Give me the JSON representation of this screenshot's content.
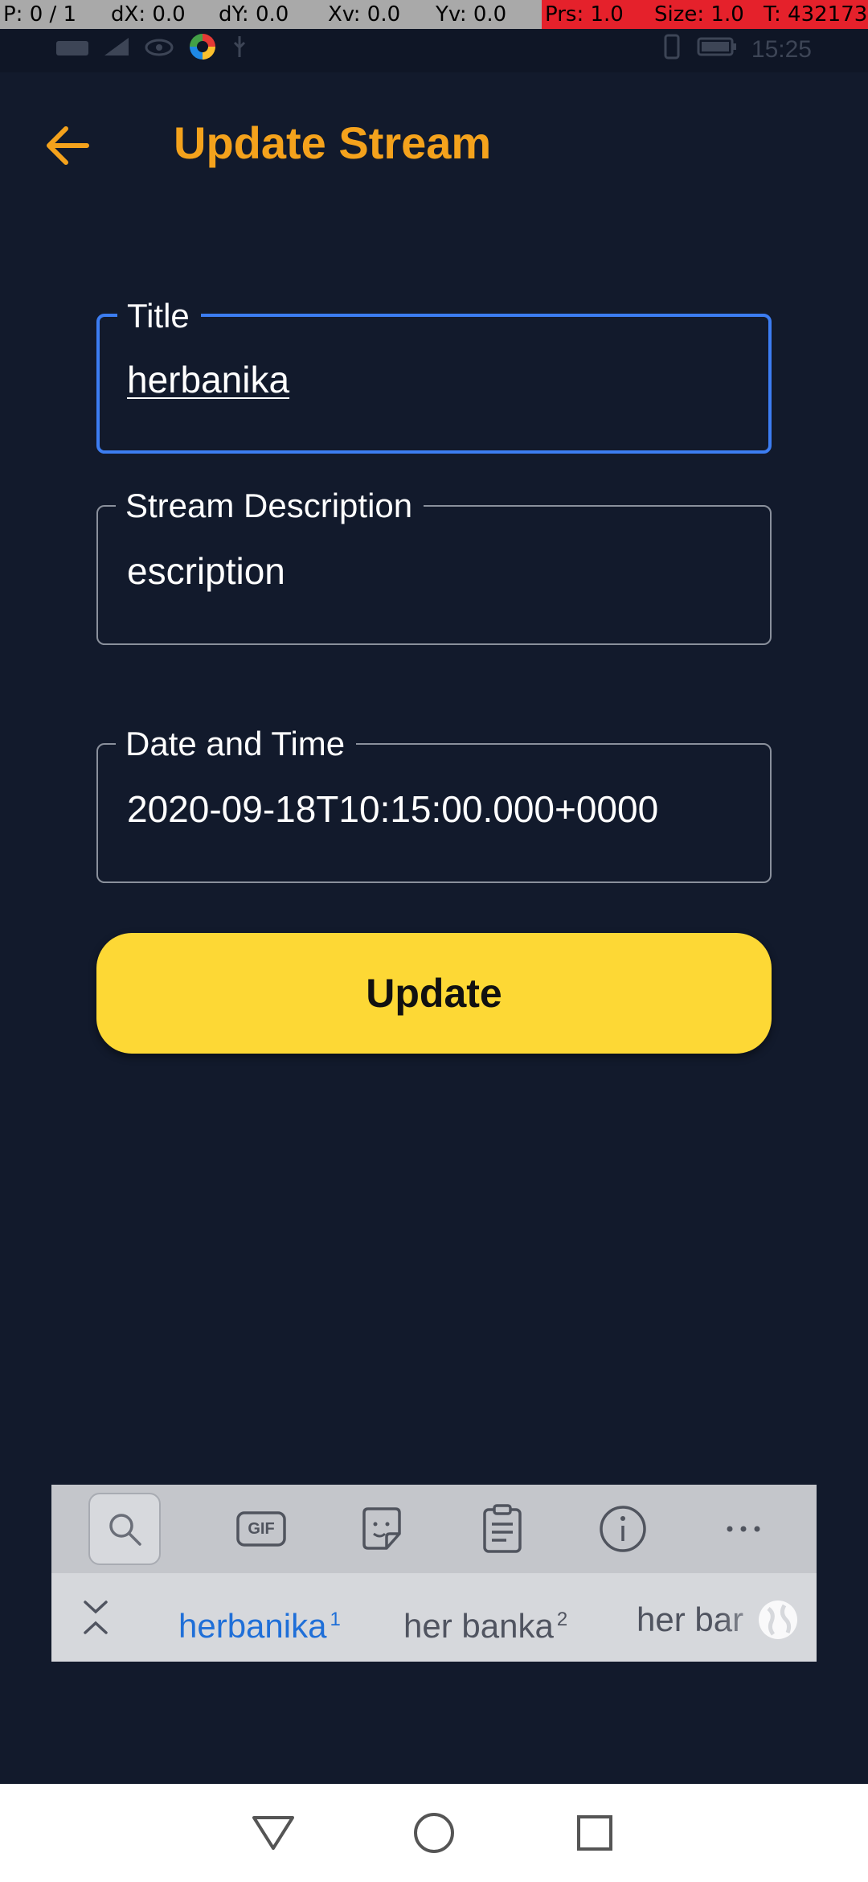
{
  "debug_bar": {
    "p": "P: 0 / 1",
    "dx": "dX: 0.0",
    "dy": "dY: 0.0",
    "xv": "Xv: 0.0",
    "yv": "Yv: 0.0",
    "prs": "Prs: 1.0",
    "size": "Size: 1.0",
    "t": "T: 432173"
  },
  "status_bar": {
    "time": "15:25"
  },
  "app_bar": {
    "title": "Update Stream",
    "back_icon": "arrow-left-icon"
  },
  "form": {
    "title": {
      "label": "Title",
      "value": "herbanika"
    },
    "description": {
      "label": "Stream Description",
      "value": "escription"
    },
    "datetime": {
      "label": "Date  and Time",
      "value": "2020-09-18T10:15:00.000+0000"
    },
    "submit_label": "Update"
  },
  "keyboard": {
    "toolbar_icons": [
      "search-icon",
      "gif-icon",
      "sticker-icon",
      "clipboard-icon",
      "info-icon",
      "more-icon"
    ],
    "gif_label": "GIF",
    "suggestions": [
      {
        "text": "herbanika",
        "index": "1"
      },
      {
        "text": "her banka",
        "index": "2"
      },
      {
        "text": "her bar",
        "index": ""
      }
    ]
  },
  "nav_bar": {
    "icons": [
      "back-triangle-icon",
      "home-circle-icon",
      "recents-square-icon"
    ]
  },
  "colors": {
    "background": "#121a2c",
    "accent": "#f4a21c",
    "focus": "#3c7df2",
    "button": "#fdd835",
    "suggestion_primary": "#1f6fd8"
  }
}
